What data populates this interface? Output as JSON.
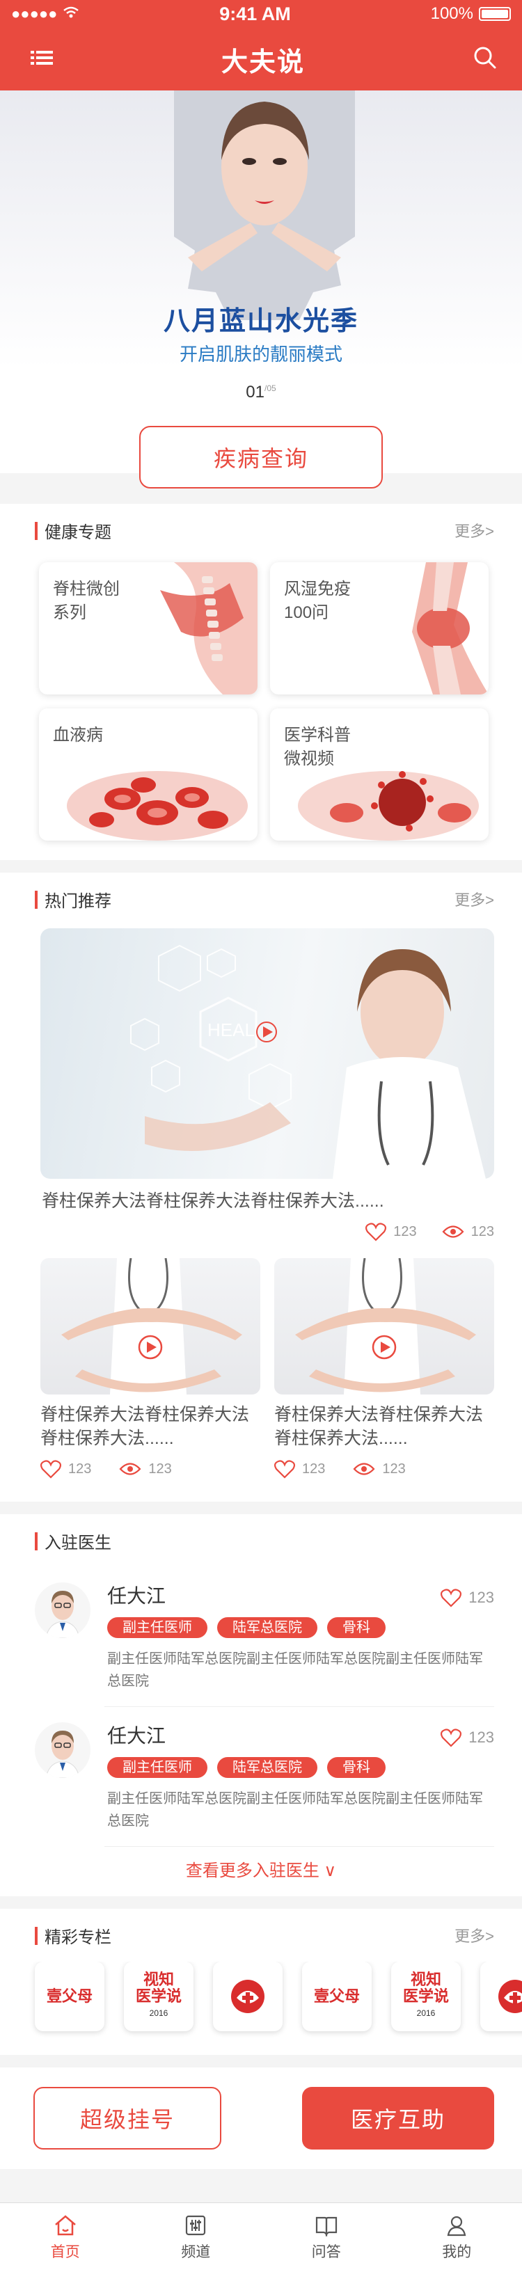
{
  "status": {
    "time": "9:41 AM",
    "battery": "100%"
  },
  "nav": {
    "title": "大夫说"
  },
  "banner": {
    "title": "八月蓝山水光季",
    "subtitle": "开启肌肤的靓丽模式",
    "page_current": "01",
    "page_total": "/05"
  },
  "query_button": "疾病查询",
  "health": {
    "title": "健康专题",
    "more": "更多>",
    "items": [
      {
        "label": "脊柱微创\n系列"
      },
      {
        "label": "风湿免疫\n100问"
      },
      {
        "label": "血液病"
      },
      {
        "label": "医学科普\n微视频"
      }
    ]
  },
  "hot": {
    "title": "热门推荐",
    "more": "更多>",
    "main": {
      "caption": "脊柱保养大法脊柱保养大法脊柱保养大法......",
      "likes": "123",
      "views": "123",
      "image_text": "HEAL"
    },
    "cards": [
      {
        "caption": "脊柱保养大法脊柱保养大法脊柱保养大法......",
        "likes": "123",
        "views": "123"
      },
      {
        "caption": "脊柱保养大法脊柱保养大法脊柱保养大法......",
        "likes": "123",
        "views": "123"
      }
    ]
  },
  "doctors": {
    "title": "入驻医生",
    "list": [
      {
        "name": "任大江",
        "tags": [
          "副主任医师",
          "陆军总医院",
          "骨科"
        ],
        "desc": "副主任医师陆军总医院副主任医师陆军总医院副主任医师陆军总医院",
        "likes": "123"
      },
      {
        "name": "任大江",
        "tags": [
          "副主任医师",
          "陆军总医院",
          "骨科"
        ],
        "desc": "副主任医师陆军总医院副主任医师陆军总医院副主任医师陆军总医院",
        "likes": "123"
      }
    ],
    "see_more": "查看更多入驻医生"
  },
  "columns": {
    "title": "精彩专栏",
    "more": "更多>",
    "items": [
      {
        "text": "壹父母",
        "sub": ""
      },
      {
        "text": "视知\n医学说",
        "sub": "2016"
      },
      {
        "text": "",
        "sub": ""
      },
      {
        "text": "壹父母",
        "sub": ""
      },
      {
        "text": "视知\n医学说",
        "sub": "2016"
      },
      {
        "text": "",
        "sub": ""
      }
    ]
  },
  "actions": {
    "left": "超级挂号",
    "right": "医疗互助"
  },
  "tabs": [
    "首页",
    "频道",
    "问答",
    "我的"
  ],
  "colors": {
    "accent": "#e94a3f"
  }
}
